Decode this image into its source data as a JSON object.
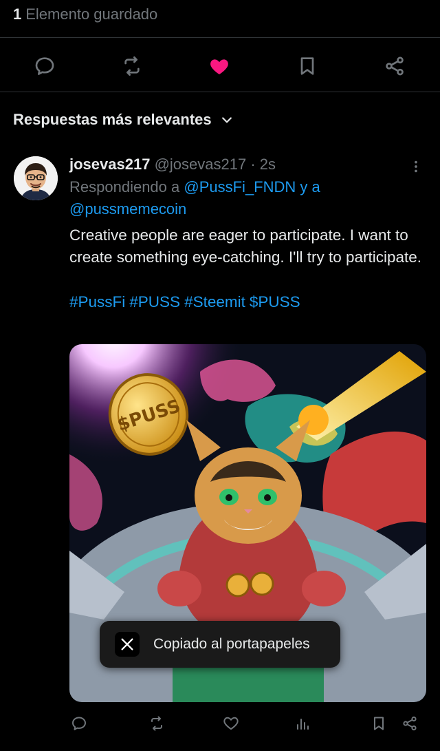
{
  "saved": {
    "count": "1",
    "label": "Elemento guardado"
  },
  "actions": {
    "reply_icon": "reply-icon",
    "repost_icon": "repost-icon",
    "like_icon": "heart-filled-icon",
    "bookmark_icon": "bookmark-icon",
    "share_icon": "share-icon",
    "like_color": "#f91880"
  },
  "sort": {
    "label": "Respuestas más relevantes"
  },
  "reply": {
    "display_name": "josevas217",
    "handle": "@josevas217",
    "separator": "·",
    "time": "2s",
    "replying_prefix": "Respondiendo a",
    "mention_1": "@PussFi_FNDN",
    "conjunction": "y a",
    "mention_2": "@pussmemecoin",
    "text": "Creative people are eager to participate. I want to create something eye-catching. I'll try to participate.",
    "hashtags": [
      "#PussFi",
      "#PUSS",
      "#Steemit",
      "$PUSS"
    ],
    "image_coin_text": "$PUSS"
  },
  "toast": {
    "message": "Copiado al portapapeles"
  },
  "colors": {
    "background": "#000000",
    "accent": "#1d9bf0",
    "muted": "#71767b",
    "text": "#e7e9ea"
  }
}
